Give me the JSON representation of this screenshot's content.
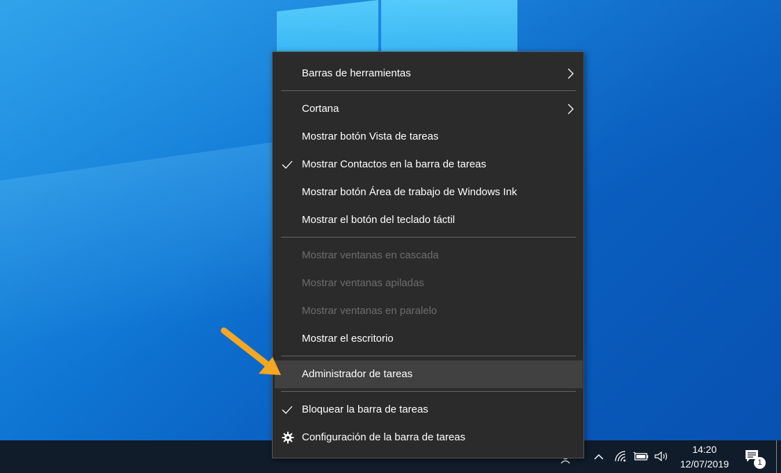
{
  "menu": {
    "items": [
      {
        "label": "Barras de herramientas"
      },
      {
        "label": "Cortana"
      },
      {
        "label": "Mostrar botón Vista de tareas"
      },
      {
        "label": "Mostrar Contactos en la barra de tareas"
      },
      {
        "label": "Mostrar botón Área de trabajo de Windows Ink"
      },
      {
        "label": "Mostrar el botón del teclado táctil"
      },
      {
        "label": "Mostrar ventanas en cascada"
      },
      {
        "label": "Mostrar ventanas apiladas"
      },
      {
        "label": "Mostrar ventanas en paralelo"
      },
      {
        "label": "Mostrar el escritorio"
      },
      {
        "label": "Administrador de tareas"
      },
      {
        "label": "Bloquear la barra de tareas"
      },
      {
        "label": "Configuración de la barra de tareas"
      }
    ]
  },
  "taskbar": {
    "time": "14:20",
    "date": "12/07/2019",
    "notification_count": "1"
  },
  "colors": {
    "menu_bg": "#2b2b2b",
    "highlight": "#414141",
    "disabled_text": "#6d6d6d",
    "annotation_arrow": "#f5a623"
  }
}
